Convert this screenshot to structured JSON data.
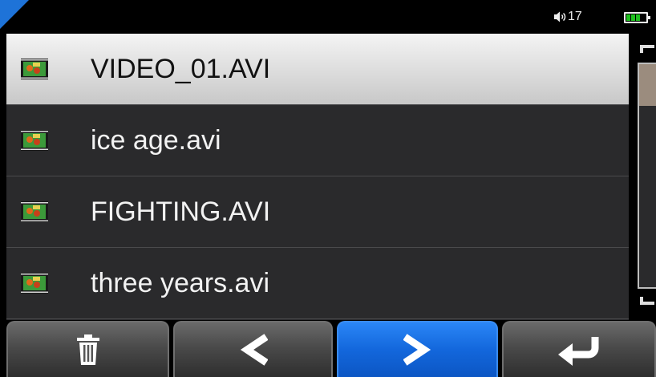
{
  "statusbar": {
    "volume_icon": "speaker-icon",
    "volume_level": "17",
    "battery_icon": "battery-icon",
    "colors": {
      "corner": "#1e73d8",
      "battery": "#1fc21f"
    }
  },
  "file_list": {
    "items": [
      {
        "icon": "video-file-icon",
        "name": "VIDEO_01.AVI",
        "selected": true
      },
      {
        "icon": "video-file-icon",
        "name": "ice age.avi",
        "selected": false
      },
      {
        "icon": "video-file-icon",
        "name": "FIGHTING.AVI",
        "selected": false
      },
      {
        "icon": "video-file-icon",
        "name": "three years.avi",
        "selected": false
      }
    ]
  },
  "toolbar": {
    "buttons": [
      {
        "icon": "trash-icon",
        "active": false
      },
      {
        "icon": "chevron-left-icon",
        "active": false
      },
      {
        "icon": "chevron-right-icon",
        "active": true
      },
      {
        "icon": "return-arrow-icon",
        "active": false
      }
    ],
    "colors": {
      "active": "#1367dc",
      "inactive": "#4a4a4a"
    }
  }
}
